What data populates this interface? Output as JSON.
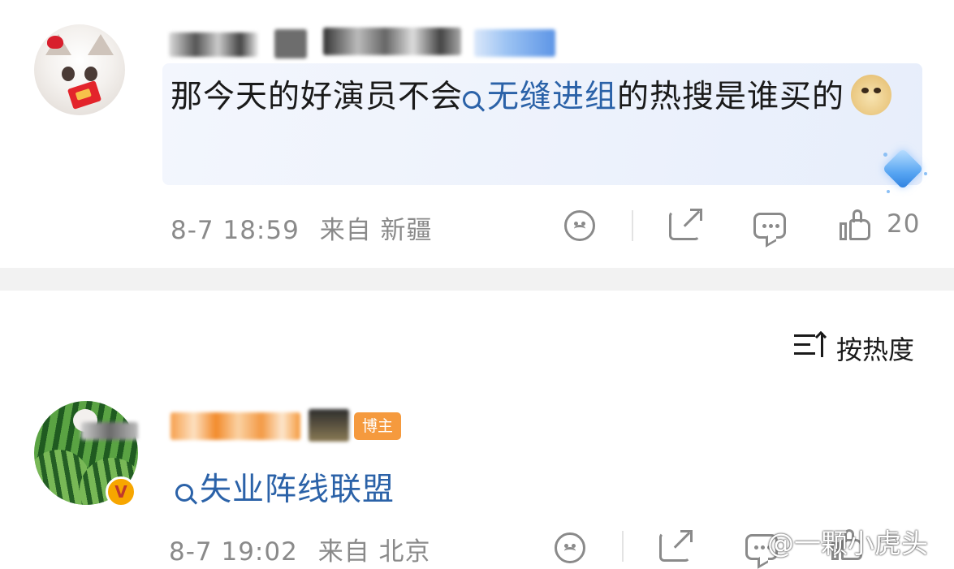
{
  "post1": {
    "username_redacted": true,
    "comment_prefix": "那今天的好演员不会",
    "topic": "无缝进组",
    "comment_suffix": "的热搜是谁买的",
    "emoji_icon": "doge-emoji-icon",
    "date_time": "8-7 18:59",
    "source": "来自 新疆",
    "like_count": "20",
    "icons": [
      "dislike-face-icon",
      "share-icon",
      "comment-icon",
      "like-icon",
      "diamond-badge-icon"
    ]
  },
  "sort": {
    "label": "按热度",
    "icon": "sort-icon"
  },
  "post2": {
    "username_redacted": true,
    "tag": "博主",
    "verified_badge": "V",
    "topic": "失业阵线联盟",
    "date_time": "8-7 19:02",
    "source": "来自 北京",
    "icons": [
      "dislike-face-icon",
      "share-icon",
      "comment-icon",
      "like-icon",
      "verified-badge-icon"
    ]
  },
  "watermark": "@一颗小虎头",
  "colors": {
    "topic_blue": "#2b62a8",
    "meta_gray": "#8a8a8a",
    "blogger_orange": "#f59a3e",
    "verified_gold": "#f7a600",
    "gap_gray": "#f2f2f2"
  }
}
